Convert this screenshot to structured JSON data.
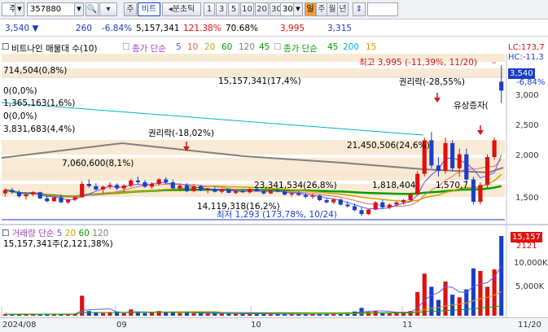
{
  "toolbar": {
    "market_label": "주",
    "code_value": "357880",
    "mode_button": "주",
    "stock_name": "비트",
    "tick_button": "◂분초틱",
    "periods": [
      "1",
      "3",
      "5",
      "10",
      "20",
      "30"
    ],
    "period_selected": "30",
    "day_label": "일",
    "ranges": [
      "주",
      "월",
      "년"
    ]
  },
  "quote": {
    "price": "3,540",
    "change": "260",
    "change_pct": "-6.84%",
    "volume": "5,157,341",
    "vol_ratio": "121.38%",
    "turnover": "70.68%",
    "high": "3,995",
    "low": "3,315"
  },
  "legend": {
    "stock": "비트나인 매물대 수(10)",
    "ma1_name": "종가 단순",
    "ma1_periods": [
      "5",
      "10",
      "20",
      "60",
      "120",
      "45"
    ],
    "ma2_name": "종가 단순",
    "ma2_periods": [
      "45",
      "200",
      "15"
    ],
    "lc": "LC:173,7",
    "hc": "HC:-11,3"
  },
  "annotations": {
    "high_label": "최고 3,995 (-11,39%, 11/20)",
    "low_label": "최저 1,293 (173,78%, 10/24)",
    "rights1": "권리락(-18,02%)",
    "rights2": "권리락(-28,55%)",
    "rights_offering": "유상증자(",
    "profile": [
      "714,504(0,8%)",
      "15,157,341(17,4%)",
      "0(0,0%)",
      "1,365,163(1,6%)",
      "0(0,0%)",
      "3,831,683(4,4%)",
      "7,060,600(8,1%)",
      "21,450,506(24,6%)",
      "23,341,534(26,8%)",
      "1,818,404",
      "1,570,7",
      "14,119,318(16,2%)"
    ]
  },
  "volume_panel": {
    "label": "거래량",
    "ma_name": "단순",
    "ma_periods": [
      "5",
      "20",
      "60",
      "120"
    ],
    "current": "15,157,341주(2,121,38%)",
    "box_value": "15,157",
    "box_sub": "2121",
    "ticks": [
      "10,000K",
      "5,000K"
    ]
  },
  "price_axis": {
    "current": "3,540",
    "current_pct": "-6,84%",
    "ticks": [
      "3,000",
      "2,500",
      "2,000",
      "1,500"
    ]
  },
  "dates": [
    "2024/08",
    "09",
    "10",
    "11",
    "11/20"
  ],
  "colors": {
    "up": "#e01010",
    "down": "#1a3ec8",
    "ma5": "#5a5af0",
    "ma20": "#c9a400",
    "ma60": "#00a000",
    "ma120": "#808080",
    "ma45": "#00b4c8",
    "ma200": "#7fd4ff",
    "ma15": "#e07060",
    "profile_band": "#f7e6cc"
  },
  "chart_data": {
    "type": "candlestick",
    "price_range": [
      1200,
      4200
    ],
    "candles": [
      [
        1700,
        1790,
        1640,
        1760
      ],
      [
        1760,
        1800,
        1690,
        1720
      ],
      [
        1720,
        1760,
        1620,
        1650
      ],
      [
        1650,
        1700,
        1590,
        1680
      ],
      [
        1680,
        1740,
        1650,
        1720
      ],
      [
        1720,
        1730,
        1600,
        1610
      ],
      [
        1610,
        1660,
        1540,
        1560
      ],
      [
        1560,
        1640,
        1550,
        1630
      ],
      [
        1630,
        1680,
        1530,
        1540
      ],
      [
        1540,
        1600,
        1510,
        1590
      ],
      [
        1590,
        1650,
        1560,
        1630
      ],
      [
        1630,
        1920,
        1620,
        1870
      ],
      [
        1870,
        1950,
        1800,
        1830
      ],
      [
        1830,
        1880,
        1750,
        1770
      ],
      [
        1770,
        1840,
        1700,
        1820
      ],
      [
        1820,
        1900,
        1780,
        1850
      ],
      [
        1850,
        1880,
        1760,
        1790
      ],
      [
        1790,
        1860,
        1720,
        1840
      ],
      [
        1840,
        1960,
        1810,
        1930
      ],
      [
        1930,
        2000,
        1870,
        1900
      ],
      [
        1900,
        1940,
        1800,
        1820
      ],
      [
        1820,
        1900,
        1780,
        1870
      ],
      [
        1870,
        1970,
        1840,
        1950
      ],
      [
        1950,
        1990,
        1860,
        1900
      ],
      [
        1900,
        1950,
        1770,
        1790
      ],
      [
        1790,
        1860,
        1740,
        1840
      ],
      [
        1840,
        1880,
        1720,
        1740
      ],
      [
        1740,
        1860,
        1720,
        1830
      ],
      [
        1830,
        1850,
        1740,
        1760
      ],
      [
        1760,
        1800,
        1700,
        1780
      ],
      [
        1780,
        1820,
        1720,
        1730
      ],
      [
        1730,
        1790,
        1700,
        1770
      ],
      [
        1770,
        1780,
        1700,
        1710
      ],
      [
        1710,
        1760,
        1680,
        1740
      ],
      [
        1740,
        1780,
        1710,
        1720
      ],
      [
        1720,
        1800,
        1700,
        1780
      ],
      [
        1780,
        1810,
        1730,
        1740
      ],
      [
        1740,
        1760,
        1680,
        1700
      ],
      [
        1700,
        1760,
        1690,
        1750
      ],
      [
        1750,
        1790,
        1720,
        1730
      ],
      [
        1730,
        1760,
        1660,
        1680
      ],
      [
        1680,
        1720,
        1640,
        1700
      ],
      [
        1700,
        1740,
        1660,
        1670
      ],
      [
        1670,
        1700,
        1610,
        1640
      ],
      [
        1640,
        1690,
        1600,
        1660
      ],
      [
        1660,
        1680,
        1560,
        1580
      ],
      [
        1580,
        1620,
        1520,
        1540
      ],
      [
        1540,
        1600,
        1510,
        1590
      ],
      [
        1590,
        1610,
        1480,
        1500
      ],
      [
        1500,
        1560,
        1450,
        1470
      ],
      [
        1470,
        1520,
        1380,
        1400
      ],
      [
        1400,
        1450,
        1293,
        1330
      ],
      [
        1330,
        1420,
        1310,
        1410
      ],
      [
        1410,
        1560,
        1400,
        1540
      ],
      [
        1540,
        1580,
        1430,
        1450
      ],
      [
        1450,
        1520,
        1420,
        1500
      ],
      [
        1500,
        1560,
        1460,
        1540
      ],
      [
        1540,
        1600,
        1500,
        1580
      ],
      [
        1580,
        1700,
        1560,
        1680
      ],
      [
        1680,
        2100,
        1660,
        2050
      ],
      [
        2050,
        2700,
        2000,
        2650
      ],
      [
        2650,
        2800,
        2150,
        2200
      ],
      [
        2200,
        2350,
        2000,
        2100
      ],
      [
        2100,
        2700,
        2050,
        2600
      ],
      [
        2600,
        2650,
        2100,
        2150
      ],
      [
        2150,
        2500,
        2000,
        2400
      ],
      [
        2400,
        2500,
        1900,
        1950
      ],
      [
        1950,
        2000,
        1500,
        1550
      ],
      [
        1550,
        1900,
        1500,
        1850
      ],
      [
        1850,
        2400,
        1800,
        2350
      ],
      [
        2350,
        2700,
        2300,
        2650
      ],
      [
        3700,
        3995,
        3315,
        3540
      ]
    ],
    "volumes": [
      300,
      250,
      280,
      320,
      260,
      300,
      350,
      280,
      260,
      300,
      400,
      3800,
      900,
      600,
      500,
      700,
      800,
      500,
      1200,
      600,
      500,
      600,
      900,
      700,
      600,
      500,
      550,
      450,
      500,
      400,
      380,
      420,
      400,
      350,
      380,
      420,
      360,
      340,
      300,
      320,
      350,
      300,
      280,
      300,
      320,
      400,
      450,
      380,
      500,
      600,
      800,
      1500,
      700,
      900,
      600,
      500,
      550,
      700,
      900,
      4500,
      8000,
      5500,
      3000,
      6500,
      4000,
      3500,
      5000,
      9000,
      8500,
      5500,
      8800,
      15157
    ]
  }
}
